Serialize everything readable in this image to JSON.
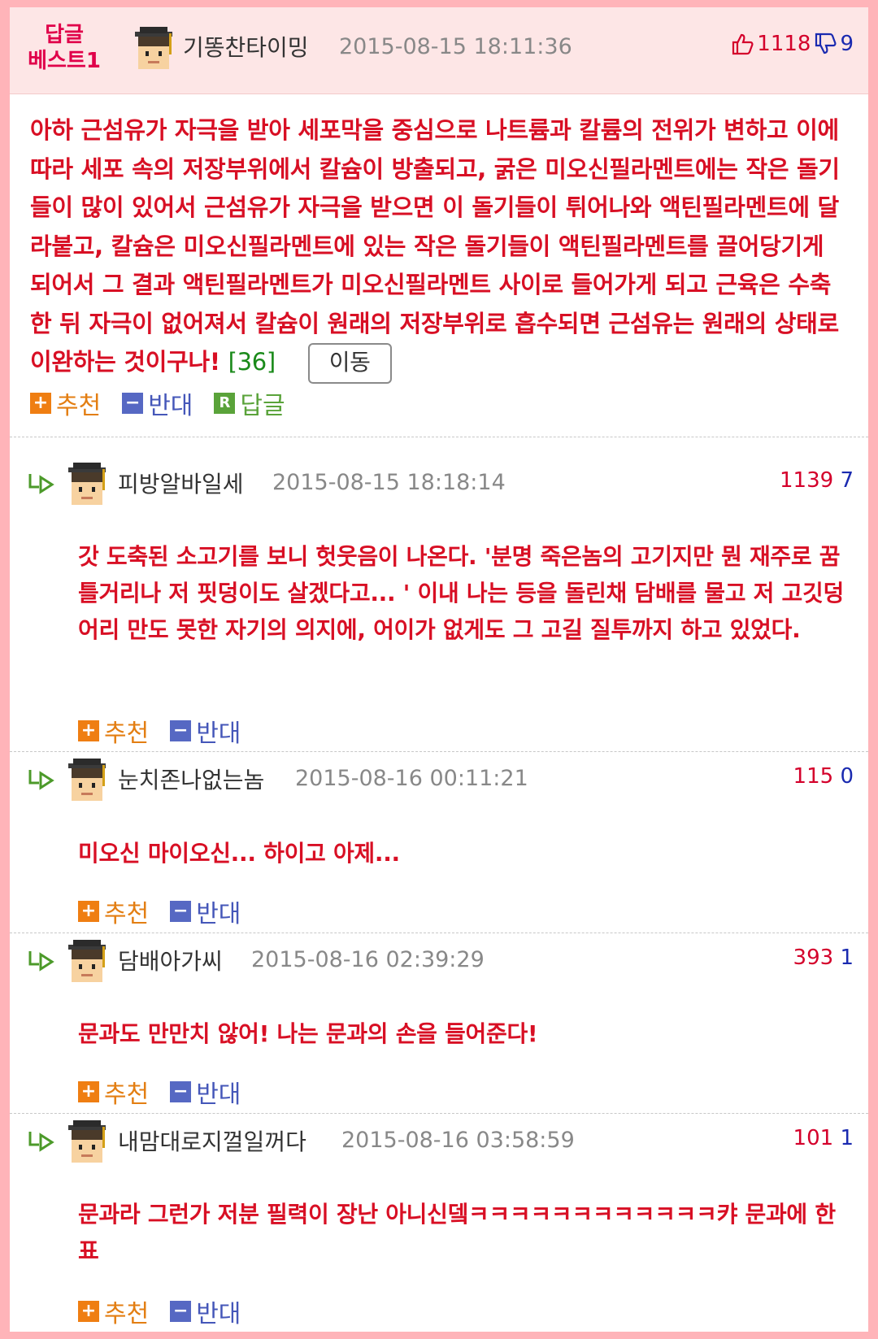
{
  "best": {
    "badge_line1": "답글",
    "badge_line2": "베스트1",
    "nickname": "기똥찬타이밍",
    "date": "2015-08-15 18:11:36",
    "up": "1118",
    "down": "9",
    "body": "아하 근섬유가 자극을 받아 세포막을 중심으로 나트륨과 칼륨의 전위가 변하고 이에 따라 세포 속의 저장부위에서 칼슘이 방출되고, 굵은 미오신필라멘트에는 작은 돌기들이 많이 있어서 근섬유가 자극을 받으면 이 돌기들이 튀어나와 액틴필라멘트에 달라붙고, 칼슘은 미오신필라멘트에 있는 작은 돌기들이 액틴필라멘트를 끌어당기게 되어서 그 결과 액틴필라멘트가 미오신필라멘트 사이로 들어가게 되고 근육은 수축한 뒤 자극이 없어져서 칼슘이 원래의 저장부위로 흡수되면 근섬유는 원래의 상태로 이완하는 것이구나!",
    "reply_count": "[36]",
    "move_label": "이동",
    "actions": {
      "recommend": "추천",
      "oppose": "반대",
      "reply": "답글",
      "reply_icon": "R"
    }
  },
  "comment_actions": {
    "recommend": "추천",
    "oppose": "반대"
  },
  "comments": [
    {
      "nickname": "피방알바일세",
      "date": "2015-08-15 18:18:14",
      "up": "1139",
      "down": "7",
      "text": "갓 도축된 소고기를 보니 헛웃음이 나온다. '분명 죽은놈의 고기지만 뭔 재주로 꿈틀거리나 저 핏덩이도 살겠다고... ' 이내 나는 등을 돌린채 담배를 물고 저 고깃덩어리 만도 못한 자기의 의지에, 어이가 없게도 그 고길 질투까지 하고 있었다."
    },
    {
      "nickname": "눈치존나없는놈",
      "date": "2015-08-16 00:11:21",
      "up": "115",
      "down": "0",
      "text": "미오신 마이오신... 하이고 아제..."
    },
    {
      "nickname": "담배아가씨",
      "date": "2015-08-16 02:39:29",
      "up": "393",
      "down": "1",
      "text": "문과도 만만치 않어! 나는 문과의 손을 들어준다!"
    },
    {
      "nickname": "내맘대로지껄일꺼다",
      "date": "2015-08-16 03:58:59",
      "up": "101",
      "down": "1",
      "text": "문과라 그런가 저분 필력이 장난 아니신뎈ㅋㅋㅋㅋㅋㅋㅋㅋㅋㅋㅋㅋ캬 문과에 한표"
    }
  ],
  "colors": {
    "frame": "#ffb4b9",
    "header_bg": "#fde6e6",
    "text_red": "#d80f24",
    "up": "#d4002b",
    "down": "#1a2ab0"
  }
}
